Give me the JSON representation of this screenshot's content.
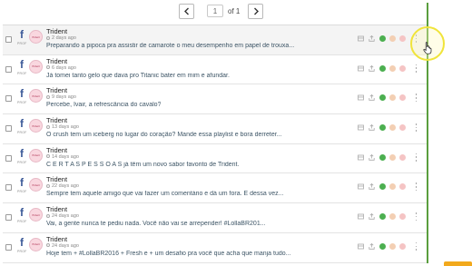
{
  "pagination": {
    "current_page": "1",
    "of_label": "of",
    "total_pages": "1"
  },
  "posts": [
    {
      "author": "Trident",
      "time": "2 days ago",
      "message": "Preparando a pipoca pra assistir de camarote o meu desempenho em papel de trouxa..."
    },
    {
      "author": "Trident",
      "time": "6 days ago",
      "message": "Já tomei tanto gelo que dava pro Titanic bater em mim e afundar."
    },
    {
      "author": "Trident",
      "time": "9 days ago",
      "message": "Percebe, Ivair, a refrescância do cavalo?"
    },
    {
      "author": "Trident",
      "time": "13 days ago",
      "message": "O crush tem um iceberg no lugar do coração? Mande essa playlist e bora derreter..."
    },
    {
      "author": "Trident",
      "time": "14 days ago",
      "message": "C E R T A S P E S S O A S já têm um novo sabor favorito de Trident."
    },
    {
      "author": "Trident",
      "time": "22 days ago",
      "message": "Sempre tem aquele amigo que vai fazer um comentário e dá um fora. E dessa vez..."
    },
    {
      "author": "Trident",
      "time": "24 days ago",
      "message": "Vai, a gente nunca te pediu nada. Você não vai se arrepender! #LollaBR201..."
    },
    {
      "author": "Trident",
      "time": "24 days ago",
      "message": "Hoje tem + #LollaBR2016 + Fresh e + um desafio pra você que acha que manja tudo..."
    }
  ],
  "network": {
    "label": "PROF"
  },
  "avatar": {
    "label": "Trident"
  },
  "colors": {
    "accent_line": "#5a9e3e",
    "sentiment_positive": "#4caf50",
    "sentiment_neutral": "#f3cfb3",
    "sentiment_negative": "#f5c4c4",
    "highlight": "#f0e43a"
  },
  "icons": [
    "prev-page-icon",
    "next-page-icon",
    "facebook-icon",
    "clock-icon",
    "archive-icon",
    "share-icon",
    "kebab-menu-icon",
    "hand-cursor-icon"
  ]
}
